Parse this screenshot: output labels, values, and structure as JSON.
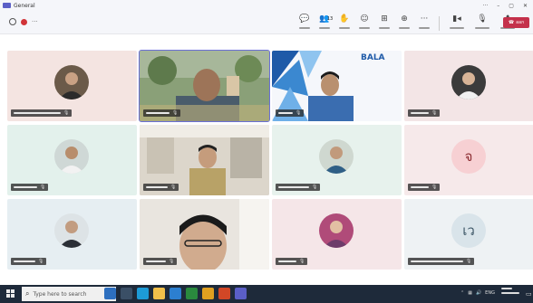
{
  "window": {
    "app_icon": "teams-logo-icon",
    "title": "General",
    "controls": [
      "···",
      "–",
      "▢",
      "✕"
    ]
  },
  "toolbar": {
    "left_icons": [
      "recording-indicator-icon",
      "recording-dot-icon",
      "more-dots-icon"
    ],
    "tools": [
      {
        "icon": "chat-icon",
        "symbol": "💬"
      },
      {
        "icon": "people-icon",
        "symbol": "👥",
        "count": "13"
      },
      {
        "icon": "raise-hand-icon",
        "symbol": "✋"
      },
      {
        "icon": "reactions-icon",
        "symbol": "☺"
      },
      {
        "icon": "view-grid-icon",
        "symbol": "⊞"
      },
      {
        "icon": "apps-icon",
        "symbol": "⊕"
      },
      {
        "icon": "more-actions-icon",
        "symbol": "···"
      }
    ],
    "media": [
      {
        "icon": "camera-icon",
        "symbol": "▮◂"
      },
      {
        "icon": "microphone-icon",
        "symbol": "🎙"
      },
      {
        "icon": "share-screen-icon",
        "symbol": "⬆"
      }
    ],
    "leave_label": "ออก",
    "leave_icon": "phone-hangup-icon"
  },
  "colors": {
    "accent": "#5b5fc7",
    "leave": "#c4314b",
    "taskbar": "#1e2a3a"
  },
  "tiles": [
    {
      "kind": "avatar",
      "bg": "#f4e4e1"
    },
    {
      "kind": "video",
      "scene": "garden",
      "bg": "#7a8b6a",
      "active": true
    },
    {
      "kind": "video",
      "scene": "bala",
      "bg": "#f5f7fb",
      "brand_text": "BALA"
    },
    {
      "kind": "avatar",
      "bg": "#f3e5e6"
    },
    {
      "kind": "avatar",
      "bg": "#e3f1ec"
    },
    {
      "kind": "video",
      "scene": "room",
      "bg": "#d8d2c6"
    },
    {
      "kind": "avatar",
      "bg": "#e7f2ed"
    },
    {
      "kind": "initial",
      "bg": "#f6e9ea",
      "letter": "จ",
      "circle": "#f7d0d3",
      "fg": "#8a2a2f"
    },
    {
      "kind": "avatar",
      "bg": "#e6eef2"
    },
    {
      "kind": "video",
      "scene": "close",
      "bg": "#e8e4de"
    },
    {
      "kind": "avatar",
      "bg": "#f5e6e8"
    },
    {
      "kind": "initial",
      "bg": "#eef2f4",
      "letter": "เว",
      "circle": "#d9e4ea",
      "fg": "#3d5666"
    }
  ],
  "taskbar": {
    "start_icon": "windows-start-icon",
    "search_placeholder": "Type here to search",
    "search_icon": "search-icon",
    "apps": [
      {
        "icon": "cortana-icon",
        "color": "#2d6fbf"
      },
      {
        "icon": "task-view-icon",
        "color": "#3a4f66"
      },
      {
        "icon": "edge-icon",
        "color": "#1d9bd7"
      },
      {
        "icon": "file-explorer-icon",
        "color": "#f2c04a"
      },
      {
        "icon": "store-icon",
        "color": "#2c7fd0"
      },
      {
        "icon": "mail-icon",
        "color": "#2a8a3e"
      },
      {
        "icon": "chrome-icon",
        "color": "#e0a020"
      },
      {
        "icon": "powerpoint-icon",
        "color": "#d24726"
      },
      {
        "icon": "teams-icon",
        "color": "#5b5fc7"
      }
    ],
    "tray_lang": "ENG"
  }
}
